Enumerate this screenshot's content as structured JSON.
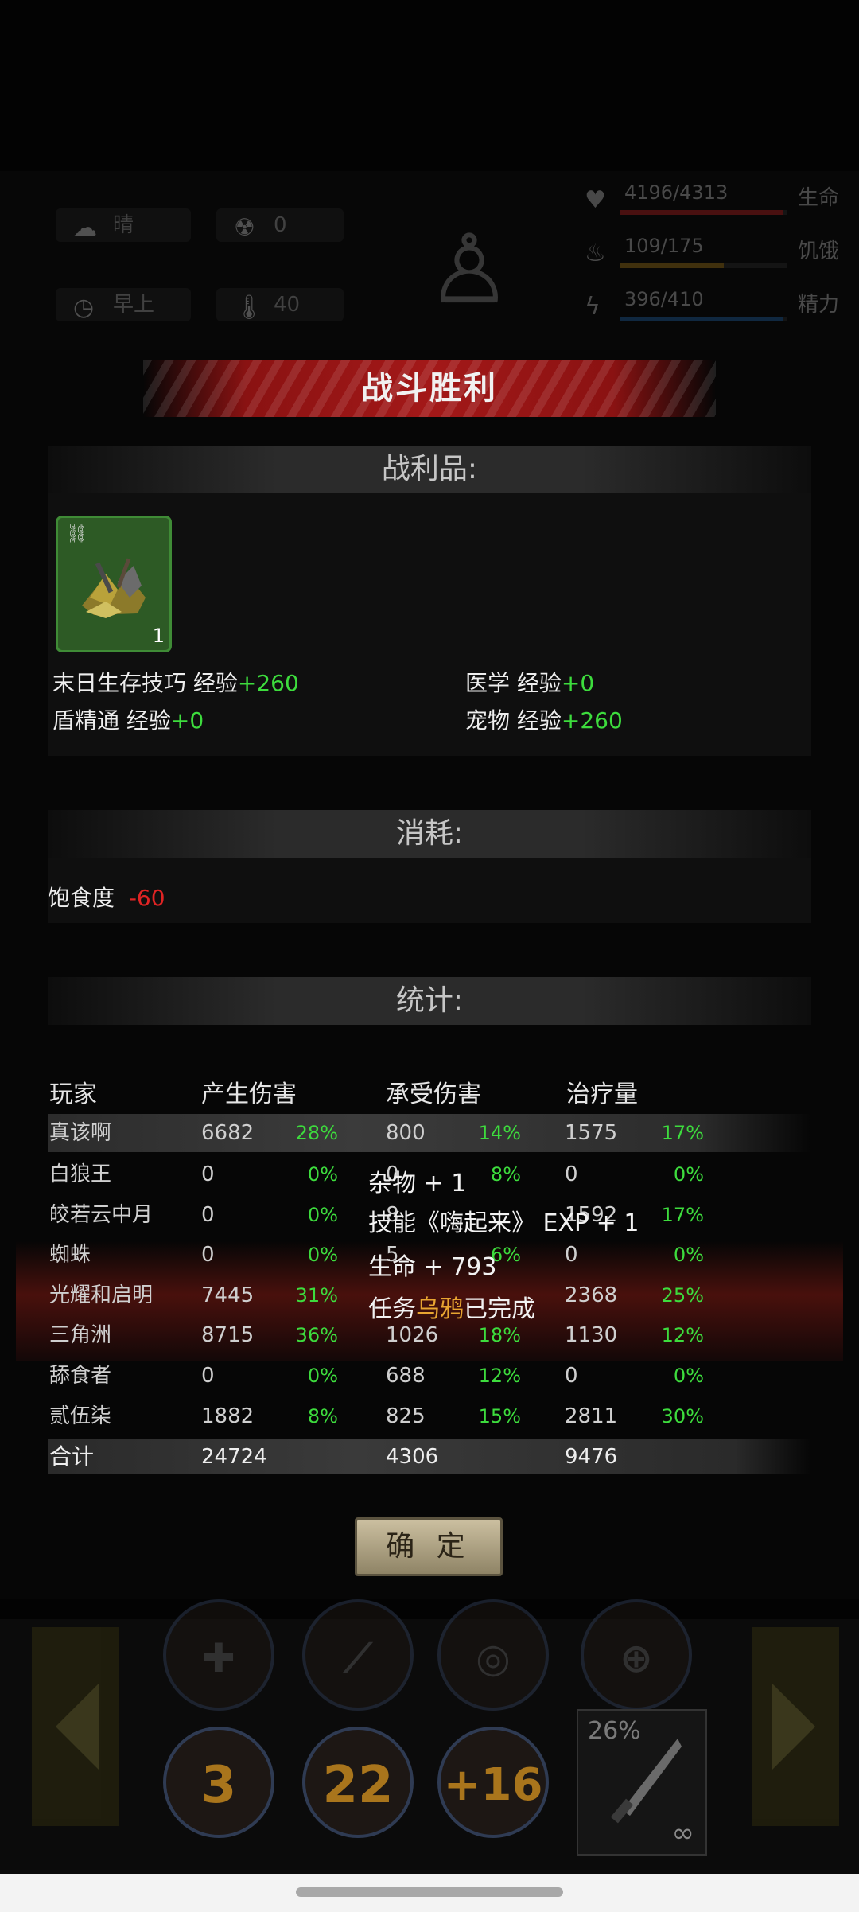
{
  "hud": {
    "weather": "晴",
    "radiation": "0",
    "time_of_day": "早上",
    "temperature": "40",
    "stats": [
      {
        "icon": "heart-icon",
        "value": "4196/4313",
        "label": "生命",
        "fraction": 0.97,
        "color": "#8a1a1a"
      },
      {
        "icon": "stomach-icon",
        "value": "109/175",
        "label": "饥饿",
        "fraction": 0.62,
        "color": "#7a5a14"
      },
      {
        "icon": "energy-icon",
        "value": "396/410",
        "label": "精力",
        "fraction": 0.97,
        "color": "#1a4a7a"
      }
    ]
  },
  "dialog": {
    "title": "战斗胜利",
    "loot_header": "战利品:",
    "loot_item_count": "1",
    "exp": [
      {
        "name": "末日生存技巧 经验",
        "delta": "+260"
      },
      {
        "name": "医学 经验",
        "delta": "+0"
      },
      {
        "name": "盾精通 经验",
        "delta": "+0"
      },
      {
        "name": "宠物 经验",
        "delta": "+260"
      }
    ],
    "consume_header": "消耗:",
    "consume": {
      "name": "饱食度",
      "delta": "-60"
    },
    "stats_header": "统计:",
    "columns": [
      "玩家",
      "产生伤害",
      "承受伤害",
      "治疗量"
    ],
    "rows": [
      {
        "player": "真该啊",
        "dmg": "6682",
        "dmg_pct": "28%",
        "taken": "800",
        "taken_pct": "14%",
        "heal": "1575",
        "heal_pct": "17%"
      },
      {
        "player": "白狼王",
        "dmg": "0",
        "dmg_pct": "0%",
        "taken": "0",
        "taken_pct": "8%",
        "heal": "0",
        "heal_pct": "0%"
      },
      {
        "player": "皎若云中月",
        "dmg": "0",
        "dmg_pct": "0%",
        "taken": "8",
        "taken_pct": "",
        "heal": "1592",
        "heal_pct": "17%"
      },
      {
        "player": "蜘蛛",
        "dmg": "0",
        "dmg_pct": "0%",
        "taken": "5",
        "taken_pct": "6%",
        "heal": "0",
        "heal_pct": "0%"
      },
      {
        "player": "光耀和启明",
        "dmg": "7445",
        "dmg_pct": "31%",
        "taken": "",
        "taken_pct": "",
        "heal": "2368",
        "heal_pct": "25%"
      },
      {
        "player": "三角洲",
        "dmg": "8715",
        "dmg_pct": "36%",
        "taken": "1026",
        "taken_pct": "18%",
        "heal": "1130",
        "heal_pct": "12%"
      },
      {
        "player": "舔食者",
        "dmg": "0",
        "dmg_pct": "0%",
        "taken": "688",
        "taken_pct": "12%",
        "heal": "0",
        "heal_pct": "0%"
      },
      {
        "player": "贰伍柒",
        "dmg": "1882",
        "dmg_pct": "8%",
        "taken": "825",
        "taken_pct": "15%",
        "heal": "2811",
        "heal_pct": "30%"
      }
    ],
    "total": {
      "label": "合计",
      "dmg": "24724",
      "taken": "4306",
      "heal": "9476"
    },
    "confirm_label": "确 定"
  },
  "notifications": [
    {
      "prefix": "杂物 + 1",
      "highlight": "",
      "suffix": ""
    },
    {
      "prefix": "技能《嗨起来》 EXP + 1",
      "highlight": "",
      "suffix": ""
    },
    {
      "prefix": "生命 + 793",
      "highlight": "",
      "suffix": ""
    },
    {
      "prefix": "任务",
      "highlight": "乌鸦",
      "suffix": "已完成"
    }
  ],
  "action_bar": {
    "skills": [
      "3",
      "22",
      "+16"
    ],
    "weapon_durability": "26%",
    "weapon_ammo": "∞"
  }
}
